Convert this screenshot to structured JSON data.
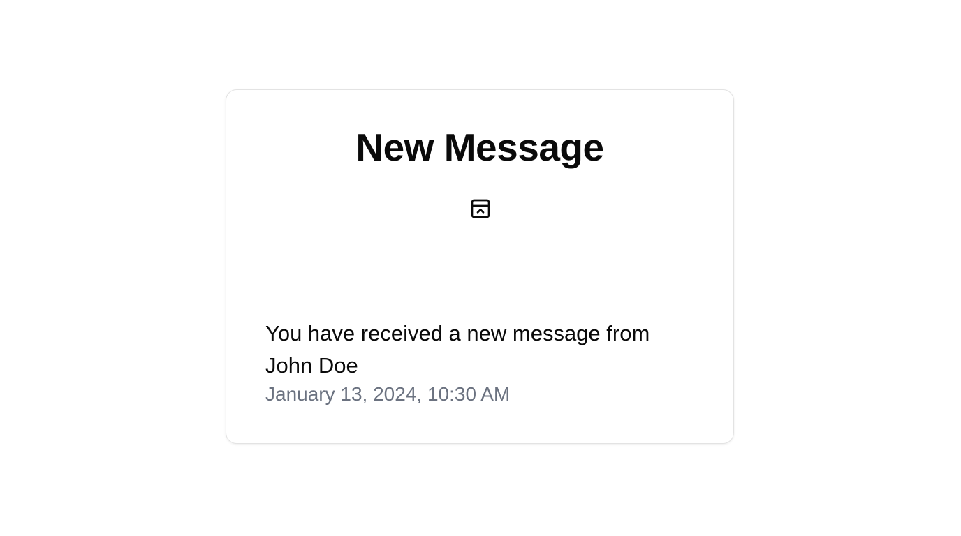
{
  "notification": {
    "title": "New Message",
    "icon": "panel-top-open-icon",
    "message": "You have received a new message from John Doe",
    "timestamp": "January 13, 2024, 10:30 AM"
  },
  "colors": {
    "text": "#0a0a0a",
    "muted": "#6b7280",
    "border": "#e3e3e3",
    "background": "#ffffff"
  }
}
